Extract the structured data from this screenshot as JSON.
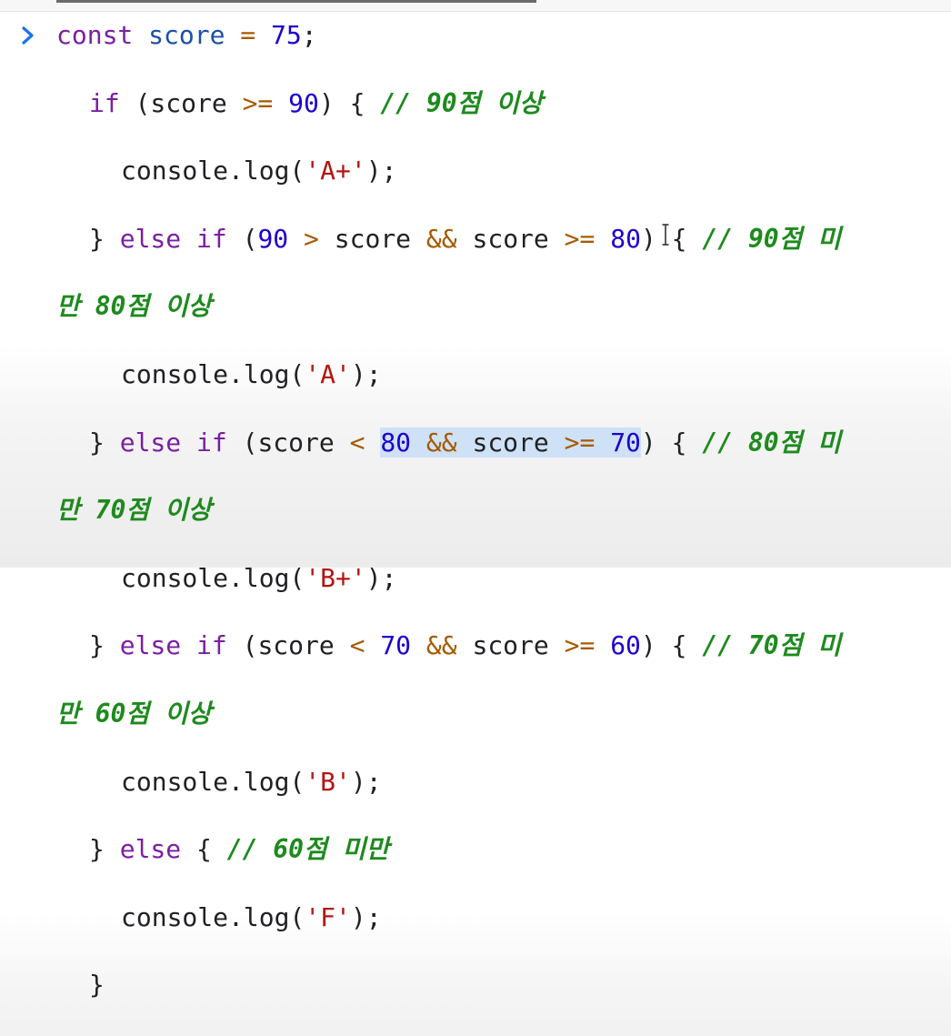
{
  "code": {
    "lines": [
      {
        "tokens": [
          {
            "t": "const ",
            "c": "kw"
          },
          {
            "t": "score",
            "c": "var"
          },
          {
            "t": " = ",
            "c": "op"
          },
          {
            "t": "75",
            "c": "num"
          },
          {
            "t": ";",
            "c": ""
          }
        ]
      },
      {
        "tokens": [
          {
            "t": "if",
            "c": "kw"
          },
          {
            "t": " (score ",
            "c": ""
          },
          {
            "t": ">=",
            "c": "op"
          },
          {
            "t": " ",
            "c": ""
          },
          {
            "t": "90",
            "c": "num"
          },
          {
            "t": ") { ",
            "c": ""
          },
          {
            "t": "// 90점 이상",
            "c": "cm"
          }
        ]
      },
      {
        "tokens": [
          {
            "t": "console.log(",
            "c": ""
          },
          {
            "t": "'A+'",
            "c": "str"
          },
          {
            "t": ");",
            "c": ""
          }
        ]
      },
      {
        "tokens": [
          {
            "t": "} ",
            "c": ""
          },
          {
            "t": "else if",
            "c": "kw"
          },
          {
            "t": " (",
            "c": ""
          },
          {
            "t": "90",
            "c": "num"
          },
          {
            "t": " ",
            "c": ""
          },
          {
            "t": ">",
            "c": "op"
          },
          {
            "t": " score ",
            "c": ""
          },
          {
            "t": "&&",
            "c": "op"
          },
          {
            "t": " score ",
            "c": ""
          },
          {
            "t": ">=",
            "c": "op"
          },
          {
            "t": " ",
            "c": ""
          },
          {
            "t": "80",
            "c": "num"
          },
          {
            "t": ") { ",
            "c": ""
          },
          {
            "t": "// 90점 미",
            "c": "cm"
          }
        ]
      },
      {
        "tokens": [
          {
            "t": "만 80점 이상",
            "c": "cm"
          }
        ]
      },
      {
        "tokens": [
          {
            "t": "console.log(",
            "c": ""
          },
          {
            "t": "'A'",
            "c": "str"
          },
          {
            "t": ");",
            "c": ""
          }
        ]
      },
      {
        "tokens": [
          {
            "t": "} ",
            "c": ""
          },
          {
            "t": "else if",
            "c": "kw"
          },
          {
            "t": " (score ",
            "c": ""
          },
          {
            "t": "<",
            "c": "op"
          },
          {
            "t": " ",
            "c": ""
          },
          {
            "t": "80",
            "c": "num",
            "sel": true
          },
          {
            "t": " ",
            "c": "",
            "sel": true
          },
          {
            "t": "&&",
            "c": "op",
            "sel": true
          },
          {
            "t": " score ",
            "c": "",
            "sel": true
          },
          {
            "t": ">=",
            "c": "op",
            "sel": true
          },
          {
            "t": " ",
            "c": "",
            "sel": true
          },
          {
            "t": "70",
            "c": "num",
            "sel": true
          },
          {
            "t": ") { ",
            "c": ""
          },
          {
            "t": "// 80점 미",
            "c": "cm"
          }
        ]
      },
      {
        "tokens": [
          {
            "t": "만 70점 이상",
            "c": "cm"
          }
        ]
      },
      {
        "tokens": [
          {
            "t": "console.log(",
            "c": ""
          },
          {
            "t": "'B+'",
            "c": "str"
          },
          {
            "t": ");",
            "c": ""
          }
        ]
      },
      {
        "tokens": [
          {
            "t": "} ",
            "c": ""
          },
          {
            "t": "else if",
            "c": "kw"
          },
          {
            "t": " (score ",
            "c": ""
          },
          {
            "t": "<",
            "c": "op"
          },
          {
            "t": " ",
            "c": ""
          },
          {
            "t": "70",
            "c": "num"
          },
          {
            "t": " ",
            "c": ""
          },
          {
            "t": "&&",
            "c": "op"
          },
          {
            "t": " score ",
            "c": ""
          },
          {
            "t": ">=",
            "c": "op"
          },
          {
            "t": " ",
            "c": ""
          },
          {
            "t": "60",
            "c": "num"
          },
          {
            "t": ") { ",
            "c": ""
          },
          {
            "t": "// 70점 미",
            "c": "cm"
          }
        ]
      },
      {
        "tokens": [
          {
            "t": "만 60점 이상",
            "c": "cm"
          }
        ]
      },
      {
        "tokens": [
          {
            "t": "console.log(",
            "c": ""
          },
          {
            "t": "'B'",
            "c": "str"
          },
          {
            "t": ");",
            "c": ""
          }
        ]
      },
      {
        "tokens": [
          {
            "t": "} ",
            "c": ""
          },
          {
            "t": "else",
            "c": "kw"
          },
          {
            "t": " { ",
            "c": ""
          },
          {
            "t": "// 60점 미만",
            "c": "cm"
          }
        ]
      },
      {
        "tokens": [
          {
            "t": "console.log(",
            "c": ""
          },
          {
            "t": "'F'",
            "c": "str"
          },
          {
            "t": ");",
            "c": ""
          }
        ]
      },
      {
        "tokens": [
          {
            "t": "}",
            "c": ""
          }
        ]
      }
    ]
  },
  "icons": {
    "prompt": "chevron-right-icon",
    "cursor": "text-cursor-icon"
  },
  "colors": {
    "keyword": "#7a1fa2",
    "variable": "#1b4fa8",
    "number": "#1c00cf",
    "operator": "#a55b00",
    "string": "#b31412",
    "comment": "#1e8a1e",
    "selection": "#cfe1f7",
    "prompt": "#1a73e8"
  }
}
